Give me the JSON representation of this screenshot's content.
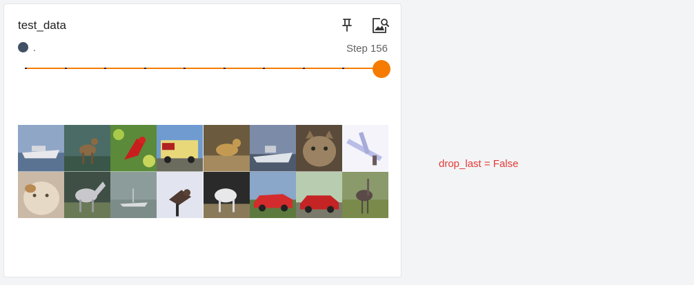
{
  "card": {
    "title": "test_data",
    "run_name": ".",
    "step_label": "Step 156",
    "pin_icon": "pin-icon",
    "image_search_icon": "image-search-icon"
  },
  "slider": {
    "value": 156,
    "max": 156,
    "accent_color": "#f57c00"
  },
  "run": {
    "color": "#425066"
  },
  "images": [
    {
      "subject": "boat"
    },
    {
      "subject": "deer"
    },
    {
      "subject": "bird"
    },
    {
      "subject": "truck"
    },
    {
      "subject": "deer"
    },
    {
      "subject": "ship"
    },
    {
      "subject": "cat"
    },
    {
      "subject": "airplane"
    },
    {
      "subject": "cat"
    },
    {
      "subject": "horse"
    },
    {
      "subject": "ship"
    },
    {
      "subject": "bird"
    },
    {
      "subject": "horse"
    },
    {
      "subject": "automobile"
    },
    {
      "subject": "automobile"
    },
    {
      "subject": "bird"
    }
  ],
  "note": {
    "text": "drop_last = False",
    "color": "#e53935"
  }
}
